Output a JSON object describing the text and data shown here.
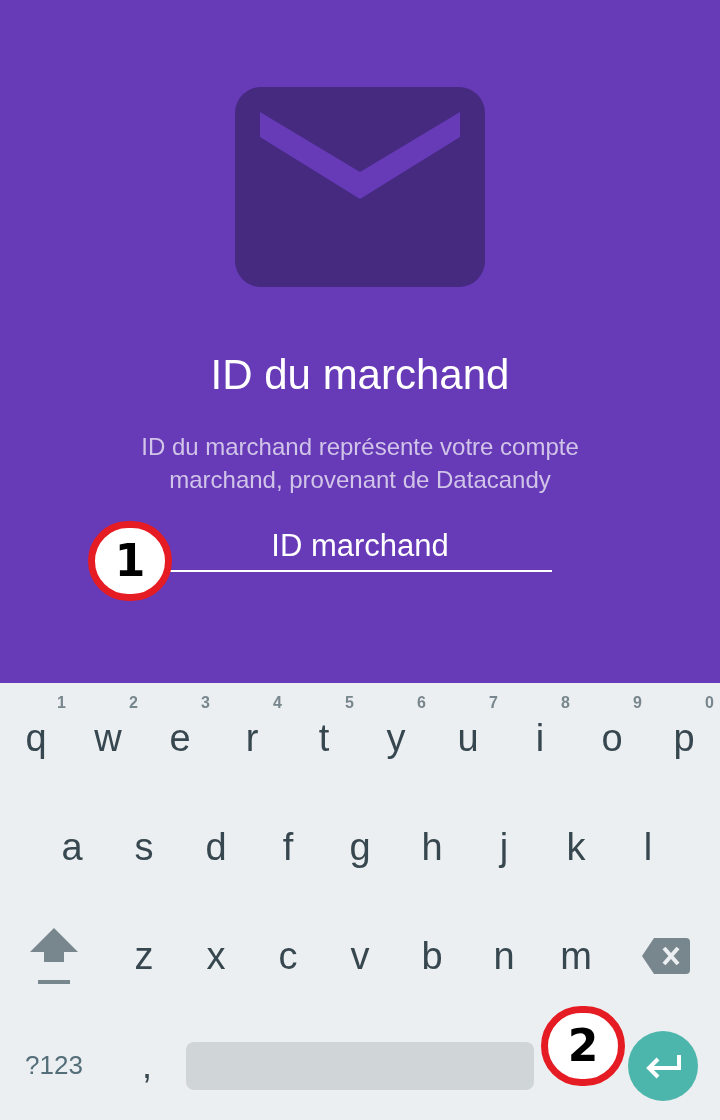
{
  "header": {
    "title": "ID du marchand",
    "description": "ID du marchand représente votre compte marchand, provenant de Datacandy",
    "field": {
      "placeholder": "ID marchand"
    }
  },
  "callouts": [
    {
      "label": "1"
    },
    {
      "label": "2"
    }
  ],
  "keyboard": {
    "rows": [
      [
        {
          "key": "q",
          "hint": "1"
        },
        {
          "key": "w",
          "hint": "2"
        },
        {
          "key": "e",
          "hint": "3"
        },
        {
          "key": "r",
          "hint": "4"
        },
        {
          "key": "t",
          "hint": "5"
        },
        {
          "key": "y",
          "hint": "6"
        },
        {
          "key": "u",
          "hint": "7"
        },
        {
          "key": "i",
          "hint": "8"
        },
        {
          "key": "o",
          "hint": "9"
        },
        {
          "key": "p",
          "hint": "0"
        }
      ],
      [
        {
          "key": "a"
        },
        {
          "key": "s"
        },
        {
          "key": "d"
        },
        {
          "key": "f"
        },
        {
          "key": "g"
        },
        {
          "key": "h"
        },
        {
          "key": "j"
        },
        {
          "key": "k"
        },
        {
          "key": "l"
        }
      ],
      [
        {
          "key": "z"
        },
        {
          "key": "x"
        },
        {
          "key": "c"
        },
        {
          "key": "v"
        },
        {
          "key": "b"
        },
        {
          "key": "n"
        },
        {
          "key": "m"
        }
      ]
    ],
    "symbols": "?123",
    "comma": ","
  }
}
